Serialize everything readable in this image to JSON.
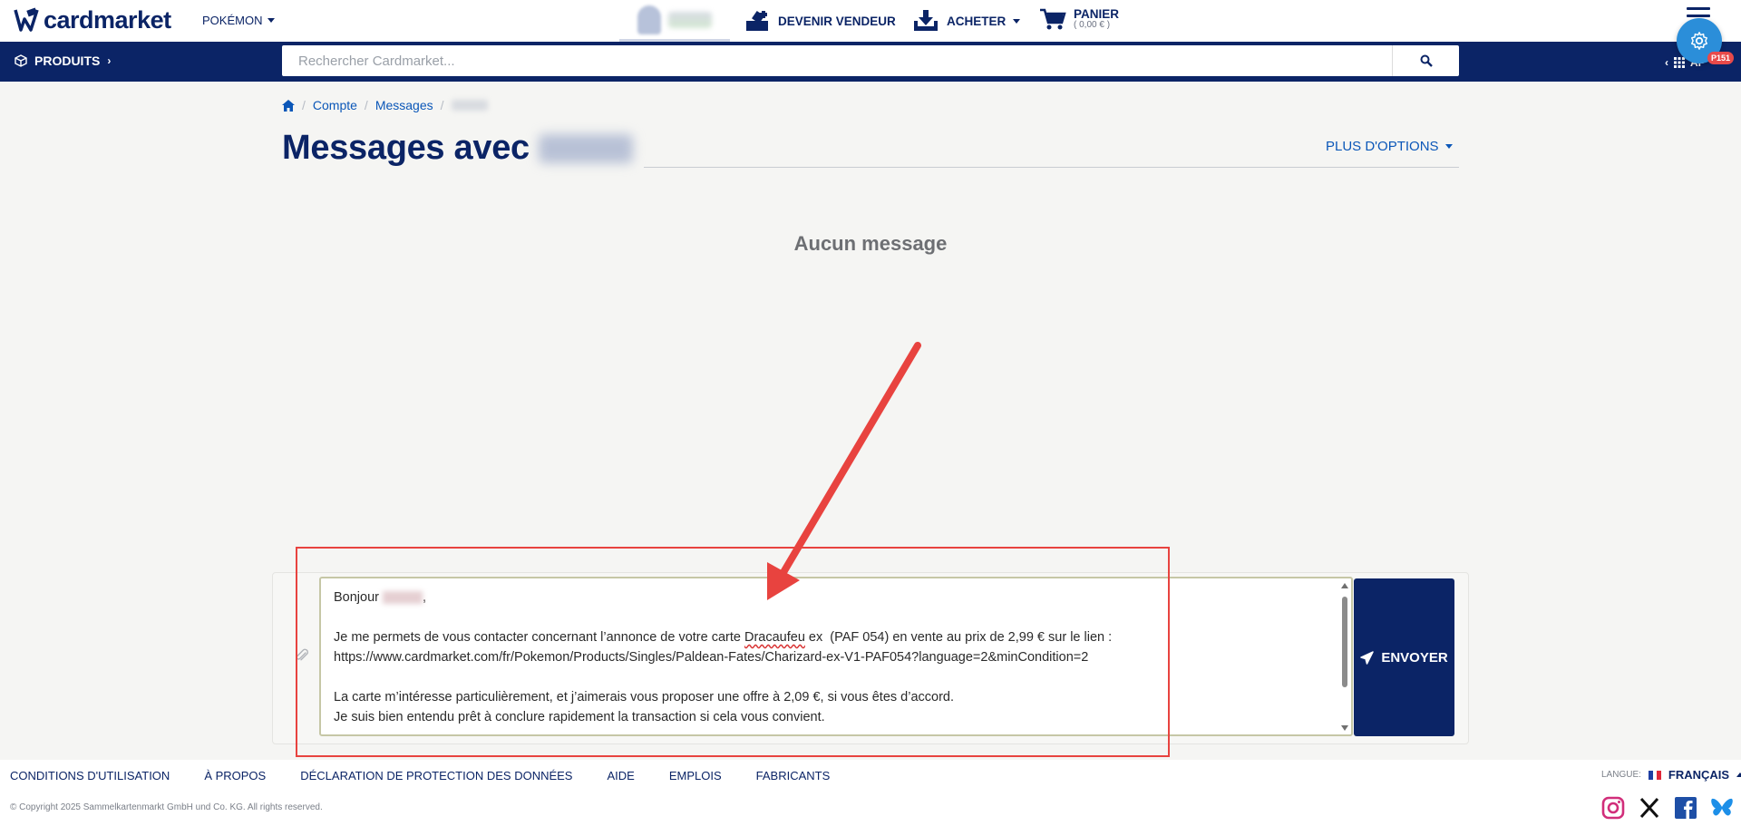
{
  "header": {
    "logo_text": "cardmarket",
    "game_selector": "POKÉMON",
    "become_seller": "DEVENIR VENDEUR",
    "buy": "ACHETER",
    "cart_label": "PANIER",
    "cart_amount": "( 0,00 € )"
  },
  "navbar": {
    "products": "PRODUITS",
    "search_placeholder": "Rechercher Cardmarket...",
    "apps_label": "AP",
    "gear_badge": "P151"
  },
  "breadcrumb": {
    "items": [
      "Compte",
      "Messages"
    ]
  },
  "page": {
    "title": "Messages avec",
    "more_options": "PLUS D'OPTIONS",
    "empty_text": "Aucun message"
  },
  "compose": {
    "greeting": "Bonjour",
    "line1_before": "Je me permets de vous contacter concernant l’annonce de votre carte ",
    "line1_word": "Dracaufeu",
    "line1_after": " ex  (PAF 054) en vente au prix de 2,99 € sur le lien :",
    "line2": "https://www.cardmarket.com/fr/Pokemon/Products/Singles/Paldean-Fates/Charizard-ex-V1-PAF054?language=2&minCondition=2",
    "line3": "La carte m’intéresse particulièrement, et j’aimerais vous proposer une offre à 2,09 €, si vous êtes d’accord.",
    "line4": "Je suis bien entendu prêt à conclure rapidement la transaction si cela vous convient.",
    "send_label": "ENVOYER"
  },
  "footer": {
    "links": [
      "CONDITIONS D'UTILISATION",
      "À PROPOS",
      "DÉCLARATION DE PROTECTION DES DONNÉES",
      "AIDE",
      "EMPLOIS",
      "FABRICANTS"
    ],
    "copyright": "© Copyright 2025 Sammelkartenmarkt GmbH und Co. KG. All rights reserved.",
    "language_label": "LANGUE:",
    "language_value": "FRANÇAIS"
  },
  "colors": {
    "brand_navy": "#0b2466",
    "link_blue": "#0b57b8",
    "annotation_red": "#e8433f",
    "fab_blue": "#2b8ed9"
  },
  "icons": [
    "home-icon",
    "cube-icon",
    "search-icon",
    "cart-icon",
    "seller-icon",
    "download-icon",
    "paperclip-icon",
    "send-icon",
    "gear-icon",
    "instagram-icon",
    "x-icon",
    "facebook-icon",
    "bluesky-icon"
  ]
}
